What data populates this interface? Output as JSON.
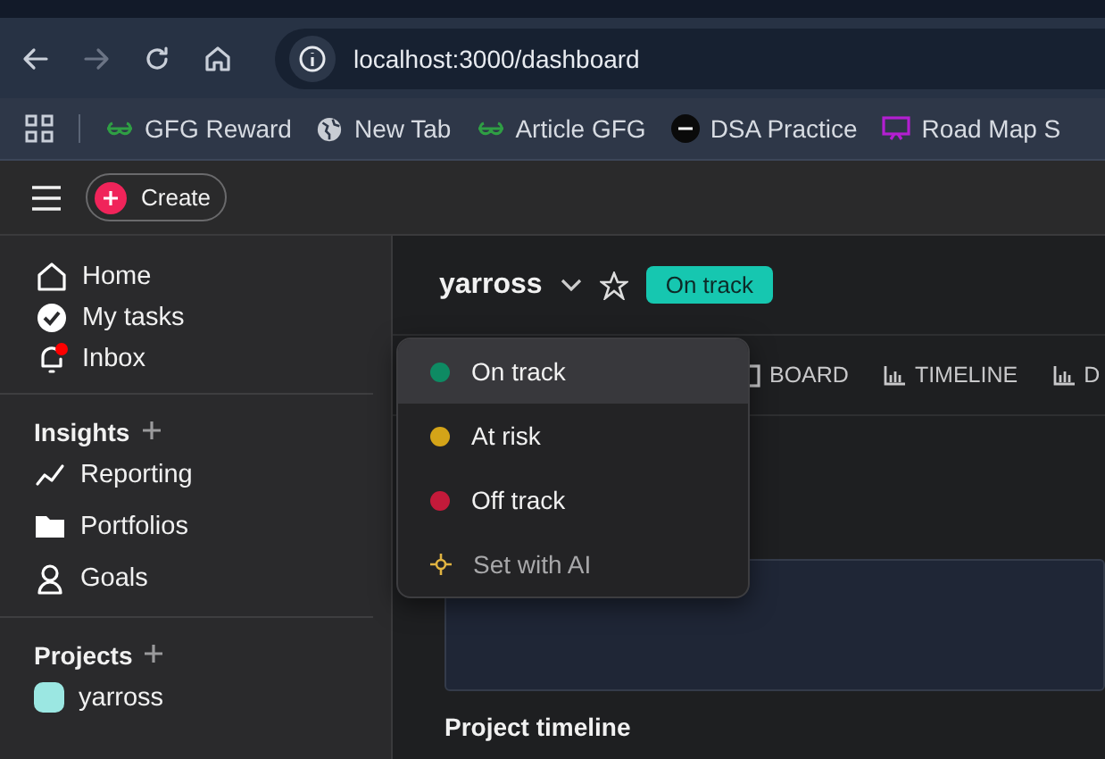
{
  "browser": {
    "url": "localhost:3000/dashboard",
    "bookmarks": [
      {
        "label": "GFG Reward",
        "kind": "gfg"
      },
      {
        "label": "New Tab",
        "kind": "globe"
      },
      {
        "label": "Article GFG",
        "kind": "gfg"
      },
      {
        "label": "DSA Practice",
        "kind": "tuf"
      },
      {
        "label": "Road Map S",
        "kind": "screen"
      }
    ]
  },
  "app_header": {
    "create_label": "Create"
  },
  "sidebar": {
    "nav": [
      {
        "label": "Home",
        "kind": "home",
        "notification": false
      },
      {
        "label": "My tasks",
        "kind": "check",
        "notification": false
      },
      {
        "label": "Inbox",
        "kind": "bell",
        "notification": true
      }
    ],
    "sections": [
      {
        "title": "Insights",
        "items": [
          {
            "label": "Reporting",
            "kind": "chart"
          },
          {
            "label": "Portfolios",
            "kind": "folder"
          },
          {
            "label": "Goals",
            "kind": "goal"
          }
        ]
      },
      {
        "title": "Projects",
        "items": [
          {
            "label": "yarross",
            "color": "#9be7e2"
          }
        ]
      }
    ]
  },
  "project": {
    "name": "yarross",
    "status": "On track",
    "views": [
      {
        "label": "BOARD",
        "kind": "board"
      },
      {
        "label": "TIMELINE",
        "kind": "bars"
      },
      {
        "label": "D",
        "kind": "bars"
      }
    ],
    "section_title": "Project timeline"
  },
  "status_menu": {
    "items": [
      {
        "label": "On track",
        "kind": "status",
        "color": "#0e8a63",
        "selected": true
      },
      {
        "label": "At risk",
        "kind": "status",
        "color": "#d4a418",
        "selected": false
      },
      {
        "label": "Off track",
        "kind": "status",
        "color": "#c41a3a",
        "selected": false
      },
      {
        "label": "Set with AI",
        "kind": "action",
        "selected": false
      }
    ]
  }
}
